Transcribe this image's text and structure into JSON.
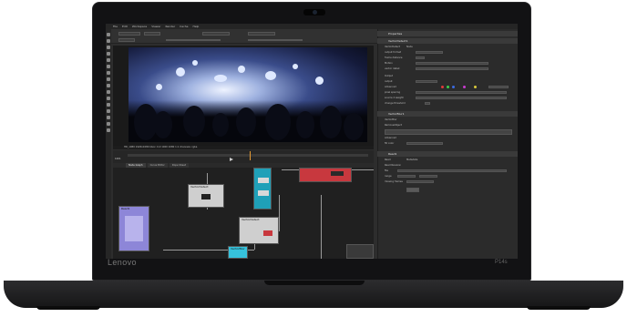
{
  "device": {
    "brand_left": "Lenovo",
    "brand_right": "P14s"
  },
  "app": {
    "menu": [
      "File",
      "Edit",
      "Workspace",
      "Viewer",
      "Render",
      "Cache",
      "Help"
    ],
    "viewer_status": "HD_1080 1920x1080 bbox: 0,0 1920 1080 1:1 channels: rgba",
    "frame_label": "1001",
    "graph_tabs": [
      "Node Graph",
      "Curve Editor",
      "Dope Sheet"
    ],
    "nodes": {
      "node_a": "VectorDetect",
      "node_b": "VectorBlur",
      "node_c": "Read1",
      "node_d": "VectorDetect"
    },
    "properties": {
      "title": "Properties",
      "panel1": "VectorDetect1",
      "panel2": "VectorBlur1",
      "panel3": "Read1",
      "panel4": "RemoveObject1",
      "rows1": [
        "VectorDetect",
        "Node",
        "output format",
        "frame distance",
        "Motion",
        "vector detail",
        "Output",
        "output",
        "Advanced",
        "pixel spacing",
        "source 2 weight",
        "change threshold"
      ],
      "rows2": [
        "VectorBlur",
        "RemoveObject",
        "Advanced",
        "fill color"
      ],
      "rows3": [
        "Read",
        "Metadata",
        "Read Revision",
        "file",
        "range",
        "missing frames"
      ]
    },
    "colors": {
      "accent": "#e59a33",
      "node_red": "#c8383e",
      "node_teal": "#1fa0b8",
      "node_purple": "#8d86d8",
      "node_grey": "#cfcfcf"
    }
  }
}
